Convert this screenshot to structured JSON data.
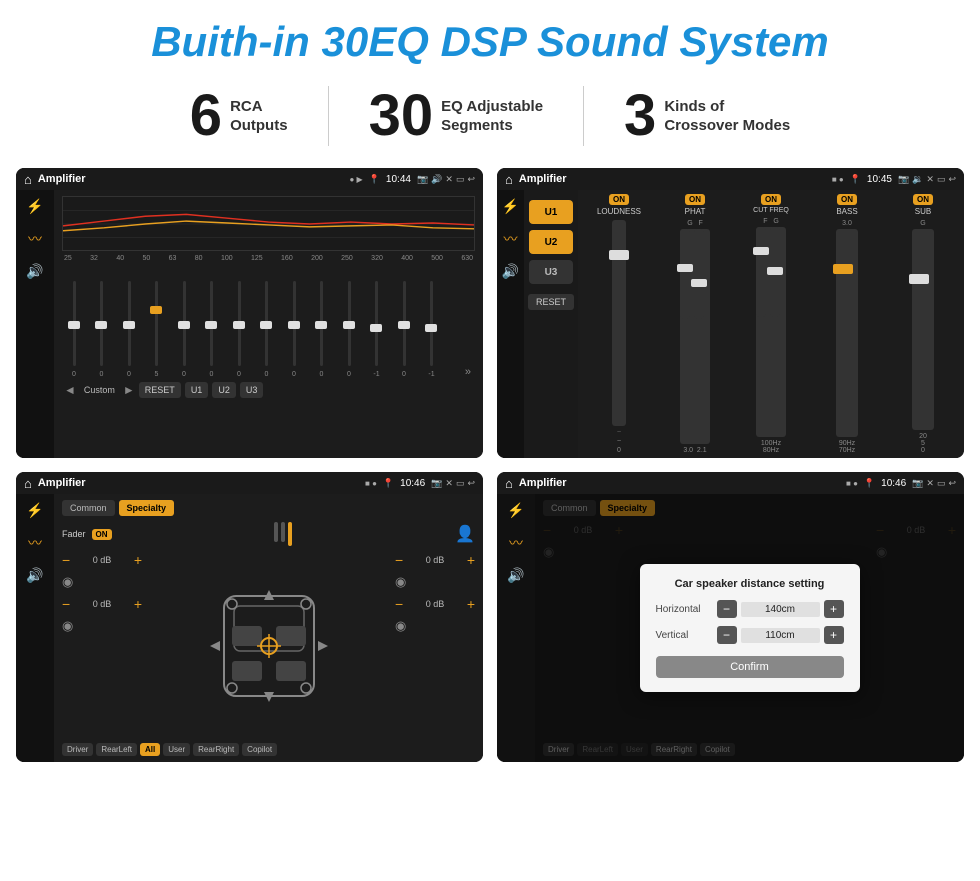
{
  "header": {
    "title": "Buith-in 30EQ DSP Sound System"
  },
  "stats": [
    {
      "number": "6",
      "label_line1": "RCA",
      "label_line2": "Outputs"
    },
    {
      "number": "30",
      "label_line1": "EQ Adjustable",
      "label_line2": "Segments"
    },
    {
      "number": "3",
      "label_line1": "Kinds of",
      "label_line2": "Crossover Modes"
    }
  ],
  "screens": [
    {
      "id": "screen1",
      "status_bar": {
        "app": "Amplifier",
        "time": "10:44"
      },
      "eq_freqs": [
        "25",
        "32",
        "40",
        "50",
        "63",
        "80",
        "100",
        "125",
        "160",
        "200",
        "250",
        "320",
        "400",
        "500",
        "630"
      ],
      "eq_values": [
        "0",
        "0",
        "0",
        "5",
        "0",
        "0",
        "0",
        "0",
        "0",
        "0",
        "0",
        "-1",
        "0",
        "-1"
      ],
      "buttons": [
        "Custom",
        "RESET",
        "U1",
        "U2",
        "U3"
      ]
    },
    {
      "id": "screen2",
      "status_bar": {
        "app": "Amplifier",
        "time": "10:45"
      },
      "presets": [
        "U1",
        "U2",
        "U3"
      ],
      "channels": [
        {
          "name": "LOUDNESS",
          "on": true
        },
        {
          "name": "PHAT",
          "on": true
        },
        {
          "name": "CUT FREQ",
          "on": true
        },
        {
          "name": "BASS",
          "on": true
        },
        {
          "name": "SUB",
          "on": true
        }
      ]
    },
    {
      "id": "screen3",
      "status_bar": {
        "app": "Amplifier",
        "time": "10:46"
      },
      "tabs": [
        "Common",
        "Specialty"
      ],
      "fader_label": "Fader",
      "fader_on": "ON",
      "db_values": [
        "0 dB",
        "0 dB",
        "0 dB",
        "0 dB"
      ],
      "bottom_buttons": [
        "Driver",
        "RearLeft",
        "All",
        "User",
        "RearRight",
        "Copilot"
      ]
    },
    {
      "id": "screen4",
      "status_bar": {
        "app": "Amplifier",
        "time": "10:46"
      },
      "tabs": [
        "Common",
        "Specialty"
      ],
      "dialog": {
        "title": "Car speaker distance setting",
        "horizontal_label": "Horizontal",
        "horizontal_value": "140cm",
        "vertical_label": "Vertical",
        "vertical_value": "110cm",
        "confirm_label": "Confirm"
      },
      "db_values": [
        "0 dB",
        "0 dB"
      ],
      "bottom_buttons": [
        "Driver",
        "RearLeft",
        "User",
        "RearRight",
        "Copilot"
      ]
    }
  ]
}
